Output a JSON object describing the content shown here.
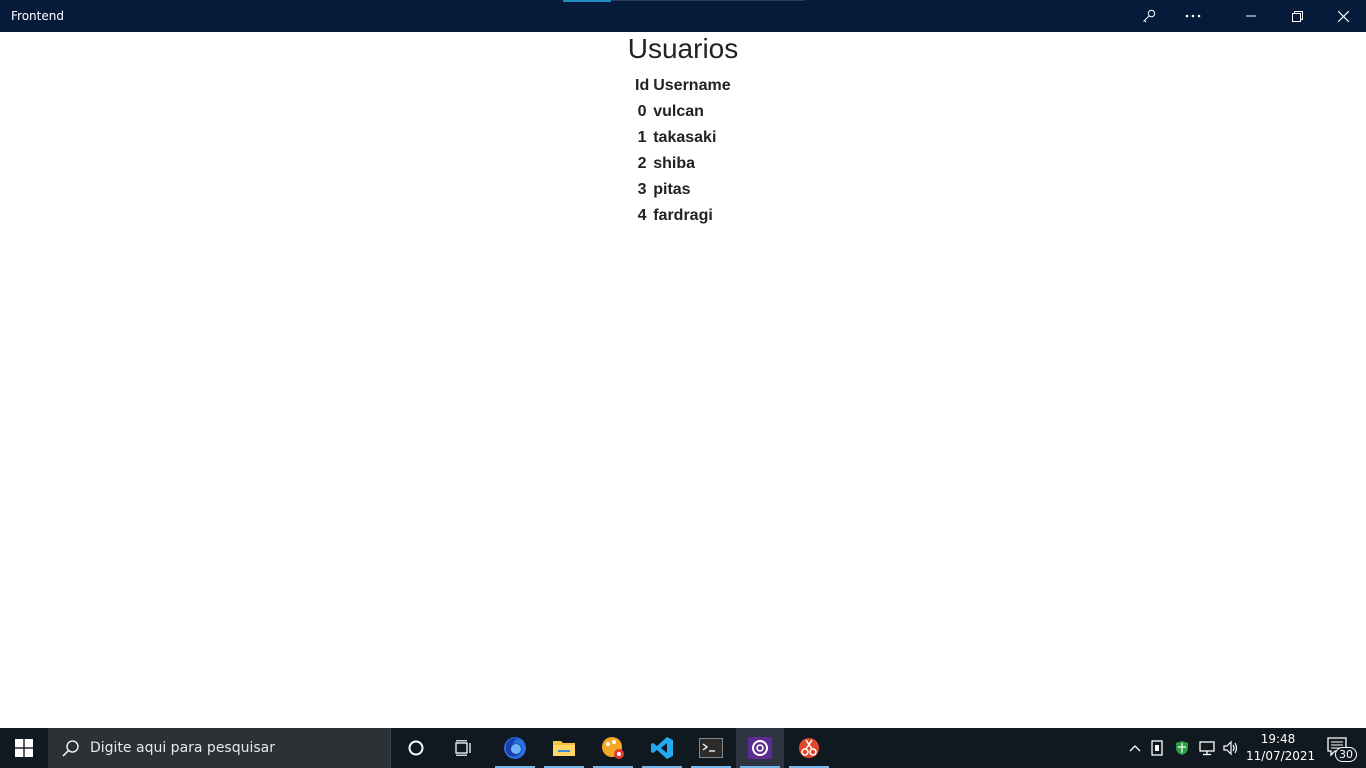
{
  "window": {
    "title": "Frontend"
  },
  "page": {
    "title": "Usuarios"
  },
  "table": {
    "headers": {
      "id": "Id",
      "username": "Username"
    },
    "rows": [
      {
        "id": "0",
        "username": "vulcan"
      },
      {
        "id": "1",
        "username": "takasaki"
      },
      {
        "id": "2",
        "username": "shiba"
      },
      {
        "id": "3",
        "username": "pitas"
      },
      {
        "id": "4",
        "username": "fardragi"
      }
    ]
  },
  "taskbar": {
    "search_placeholder": "Digite aqui para pesquisar",
    "apps": [
      "firefox-icon",
      "file-explorer-icon",
      "paint-app-icon",
      "vscode-icon",
      "terminal-icon",
      "blazor-app-icon",
      "snipping-tool-icon"
    ],
    "clock": {
      "time": "19:48",
      "date": "11/07/2021"
    },
    "notification_count": "30"
  },
  "colors": {
    "titlebar": "#061a3a",
    "taskbar": "#101820",
    "accent": "#76b9ed"
  }
}
